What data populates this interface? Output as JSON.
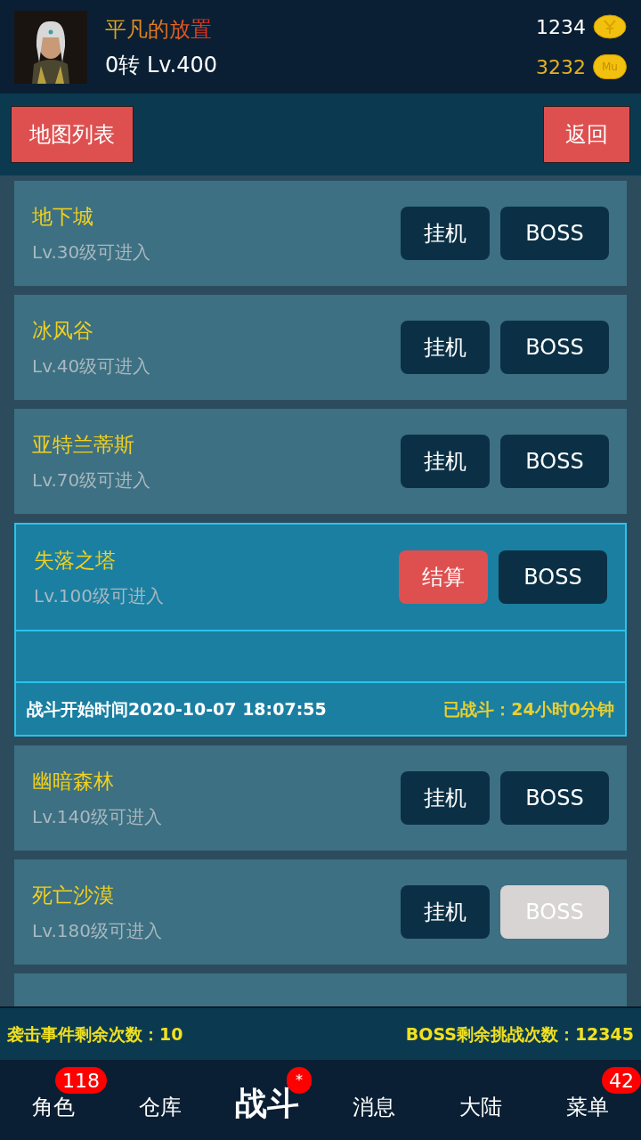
{
  "player": {
    "name": "平凡的放置",
    "level": "0转 Lv.400"
  },
  "currencies": [
    {
      "amount": "1234",
      "kind": "yuan"
    },
    {
      "amount": "3232",
      "kind": "mu",
      "coin_label": "Mu"
    }
  ],
  "toolbar": {
    "left_button": "地图列表",
    "right_button": "返回"
  },
  "maps": [
    {
      "name": "地下城",
      "requirement": "Lv.30级可进入",
      "active": false,
      "action": "挂机",
      "boss": "BOSS",
      "boss_disabled": false
    },
    {
      "name": "冰风谷",
      "requirement": "Lv.40级可进入",
      "active": false,
      "action": "挂机",
      "boss": "BOSS",
      "boss_disabled": false
    },
    {
      "name": "亚特兰蒂斯",
      "requirement": "Lv.70级可进入",
      "active": false,
      "action": "挂机",
      "boss": "BOSS",
      "boss_disabled": false
    },
    {
      "name": "失落之塔",
      "requirement": "Lv.100级可进入",
      "active": true,
      "action": "结算",
      "boss": "BOSS",
      "boss_disabled": false,
      "start_time": "战斗开始时间2020-10-07 18:07:55",
      "elapsed": "已战斗：24小时0分钟"
    },
    {
      "name": "幽暗森林",
      "requirement": "Lv.140级可进入",
      "active": false,
      "action": "挂机",
      "boss": "BOSS",
      "boss_disabled": false
    },
    {
      "name": "死亡沙漠",
      "requirement": "Lv.180级可进入",
      "active": false,
      "action": "挂机",
      "boss": "BOSS",
      "boss_disabled": true
    }
  ],
  "status_bar": {
    "raid_count": "袭击事件剩余次数：10",
    "boss_count": "BOSS剩余挑战次数：12345"
  },
  "tabs": [
    {
      "label": "角色",
      "selected": false,
      "badge": "118"
    },
    {
      "label": "仓库",
      "selected": false
    },
    {
      "label": "战斗",
      "selected": true,
      "badge": "*"
    },
    {
      "label": "消息",
      "selected": false
    },
    {
      "label": "大陆",
      "selected": false
    },
    {
      "label": "菜单",
      "selected": false,
      "badge": "42"
    }
  ]
}
